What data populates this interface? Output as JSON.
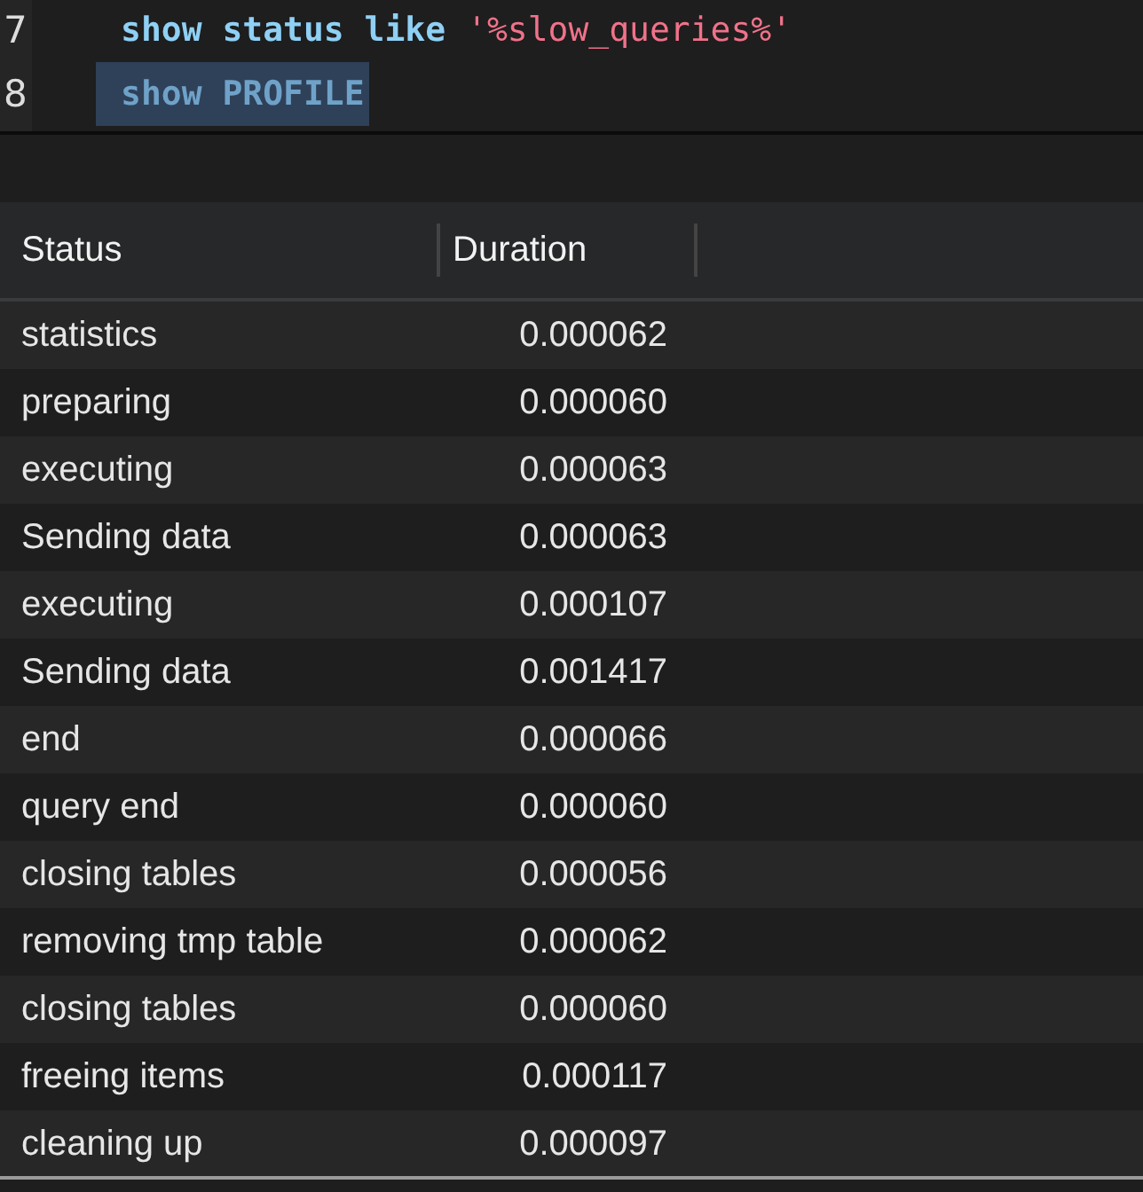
{
  "editor": {
    "lines": [
      {
        "number": "7",
        "selected": false,
        "tokens": [
          {
            "kind": "keyword",
            "text": "show status like"
          },
          {
            "kind": "string",
            "text": "'%slow_queries%'"
          }
        ]
      },
      {
        "number": "8",
        "selected": true,
        "tokens": [
          {
            "kind": "keyword",
            "text": "show PROFILE"
          }
        ]
      }
    ]
  },
  "table": {
    "columns": [
      "Status",
      "Duration"
    ],
    "rows": [
      {
        "status": "statistics",
        "duration": "0.000062"
      },
      {
        "status": "preparing",
        "duration": "0.000060"
      },
      {
        "status": "executing",
        "duration": "0.000063"
      },
      {
        "status": "Sending data",
        "duration": "0.000063"
      },
      {
        "status": "executing",
        "duration": "0.000107"
      },
      {
        "status": "Sending data",
        "duration": "0.001417"
      },
      {
        "status": "end",
        "duration": "0.000066"
      },
      {
        "status": "query end",
        "duration": "0.000060"
      },
      {
        "status": "closing tables",
        "duration": "0.000056"
      },
      {
        "status": "removing tmp table",
        "duration": "0.000062"
      },
      {
        "status": "closing tables",
        "duration": "0.000060"
      },
      {
        "status": "freeing items",
        "duration": "0.000117"
      },
      {
        "status": "cleaning up",
        "duration": "0.000097"
      }
    ]
  }
}
